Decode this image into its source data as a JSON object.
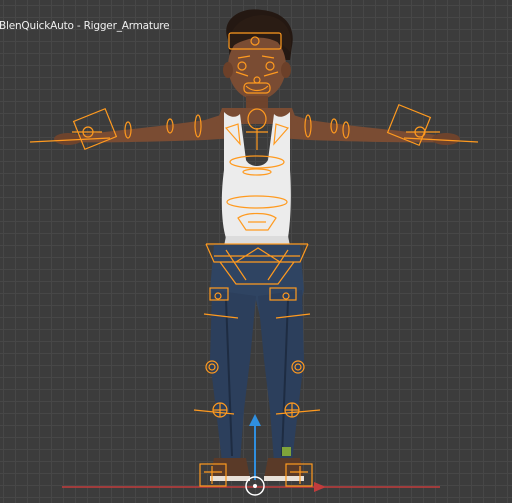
{
  "viewport": {
    "object_name": "BlenQuickAuto - Rigger_Armature",
    "colors": {
      "background": "#3c3c3c",
      "grid": "#474747",
      "rig_wire": "#ff9a1f",
      "x_axis": "#c23c3c",
      "y_axis": "#7fa33a",
      "z_gizmo": "#2f8fe0",
      "skin": "#7a4c33",
      "tank_top": "#ececec",
      "jeans": "#2c3f5c"
    },
    "icons": [
      "z-axis-arrow-icon",
      "y-axis-handle-icon",
      "origin-cursor-icon"
    ]
  }
}
